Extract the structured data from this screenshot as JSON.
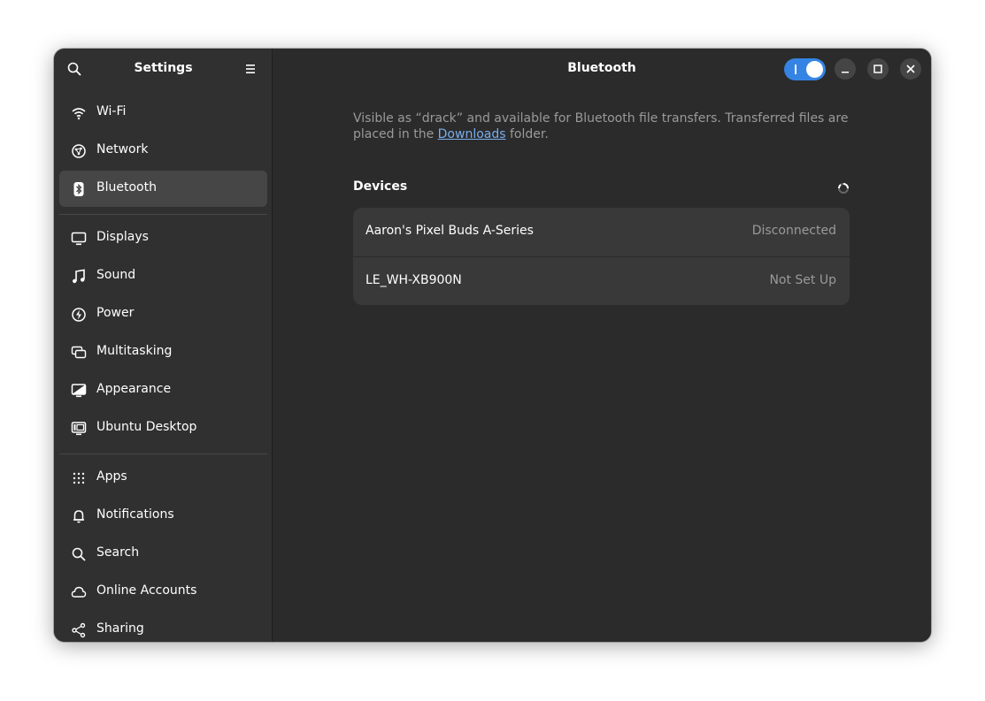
{
  "sidebar": {
    "title": "Settings",
    "search_icon": "search-icon",
    "menu_icon": "hamburger-menu-icon",
    "groups": [
      [
        {
          "label": "Wi-Fi",
          "icon": "wifi-icon"
        },
        {
          "label": "Network",
          "icon": "network-icon"
        },
        {
          "label": "Bluetooth",
          "icon": "bluetooth-icon",
          "active": true
        }
      ],
      [
        {
          "label": "Displays",
          "icon": "display-icon"
        },
        {
          "label": "Sound",
          "icon": "music-note-icon"
        },
        {
          "label": "Power",
          "icon": "power-icon"
        },
        {
          "label": "Multitasking",
          "icon": "multitasking-icon"
        },
        {
          "label": "Appearance",
          "icon": "appearance-icon"
        },
        {
          "label": "Ubuntu Desktop",
          "icon": "ubuntu-desktop-icon"
        }
      ],
      [
        {
          "label": "Apps",
          "icon": "apps-grid-icon"
        },
        {
          "label": "Notifications",
          "icon": "bell-icon"
        },
        {
          "label": "Search",
          "icon": "search-icon"
        },
        {
          "label": "Online Accounts",
          "icon": "cloud-icon"
        },
        {
          "label": "Sharing",
          "icon": "share-icon"
        }
      ]
    ]
  },
  "main": {
    "title": "Bluetooth",
    "bluetooth_enabled": true,
    "description_pre": "Visible as “drack” and available for Bluetooth file transfers. Transferred files are placed in the ",
    "description_link": "Downloads",
    "description_post": " folder.",
    "devices_heading": "Devices",
    "devices": [
      {
        "name": "Aaron's Pixel Buds A-Series",
        "status": "Disconnected"
      },
      {
        "name": "LE_WH-XB900N",
        "status": "Not Set Up"
      }
    ]
  },
  "colors": {
    "accent": "#3584e4",
    "link": "#78aeed",
    "sidebar_bg": "#303030",
    "main_bg": "#2b2b2b"
  }
}
